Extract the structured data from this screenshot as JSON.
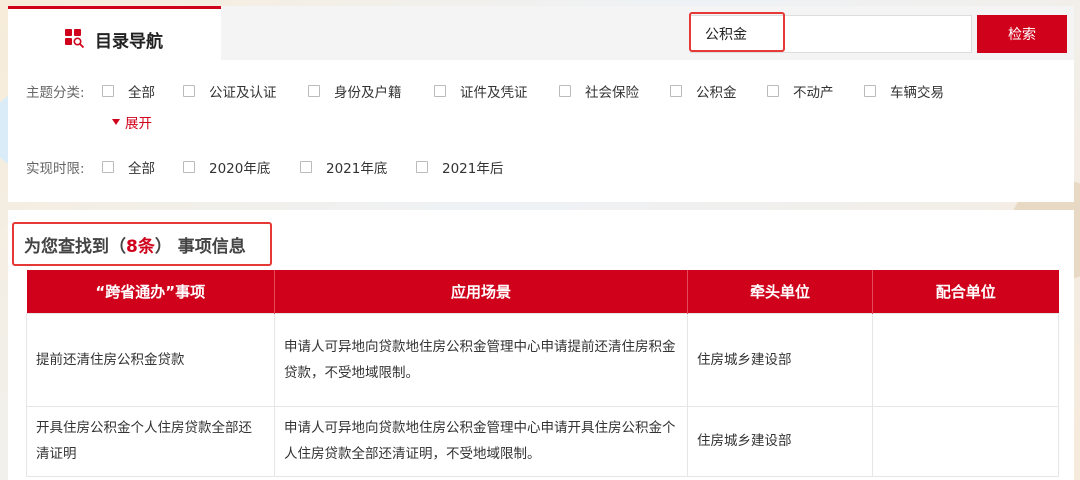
{
  "nav": {
    "tab_label": "目录导航",
    "tab_icon": "catalog-icon",
    "accent_color": "#d0021b"
  },
  "search": {
    "value": "公积金",
    "button_label": "检索"
  },
  "filters": {
    "topic": {
      "label": "主题分类:",
      "options": [
        "全部",
        "公证及认证",
        "身份及户籍",
        "证件及凭证",
        "社会保险",
        "公积金",
        "不动产",
        "车辆交易"
      ],
      "expand_label": "展开"
    },
    "time": {
      "label": "实现时限:",
      "options": [
        "全部",
        "2020年底",
        "2021年底",
        "2021年后"
      ]
    }
  },
  "results": {
    "prefix": "为您查找到（",
    "count": "8条",
    "suffix": "） 事项信息",
    "columns": [
      "“跨省通办”事项",
      "应用场景",
      "牵头单位",
      "配合单位"
    ],
    "rows": [
      {
        "item": "提前还清住房公积金贷款",
        "scenario": "申请人可异地向贷款地住房公积金管理中心申请提前还清住房积金贷款，不受地域限制。",
        "lead": "住房城乡建设部",
        "partner": ""
      },
      {
        "item": "开具住房公积金个人住房贷款全部还清证明",
        "scenario": "申请人可异地向贷款地住房公积金管理中心申请开具住房公积金个人住房贷款全部还清证明，不受地域限制。",
        "lead": "住房城乡建设部",
        "partner": ""
      }
    ]
  }
}
